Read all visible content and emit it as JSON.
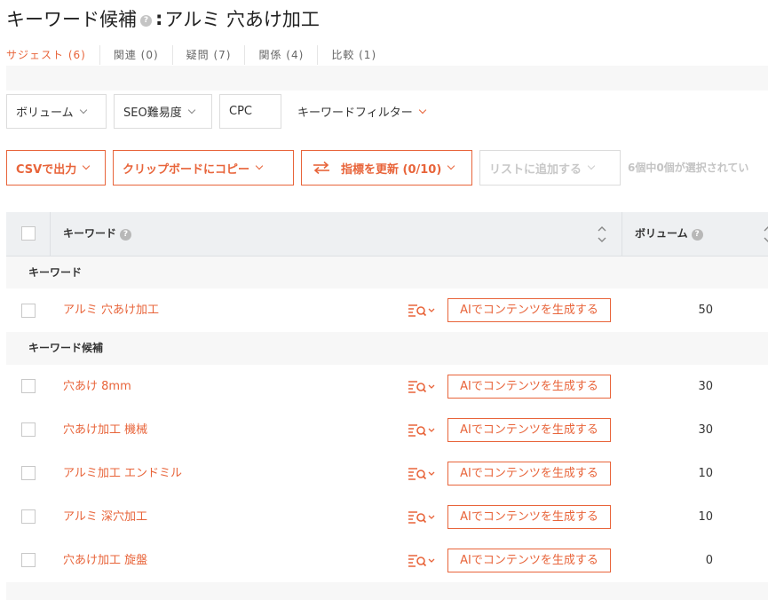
{
  "header": {
    "title_prefix": "キーワード候補",
    "help": "?",
    "colon": ":",
    "title_query": "アルミ 穴あけ加工"
  },
  "tabs": [
    {
      "label": "サジェスト (6)",
      "active": true
    },
    {
      "label": "関連 (0)"
    },
    {
      "label": "疑問 (7)"
    },
    {
      "label": "関係 (4)"
    },
    {
      "label": "比較 (1)"
    }
  ],
  "filters": {
    "volume": "ボリューム",
    "seo_difficulty": "SEO難易度",
    "cpc": "CPC",
    "keyword_filter": "キーワードフィルター"
  },
  "actions": {
    "csv": "CSVで出力",
    "clipboard": "クリップボードにコピー",
    "refresh": "指標を更新 (0/10)",
    "add_to_list": "リストに追加する",
    "selection_info": "6個中0個が選択されてい"
  },
  "table": {
    "headers": {
      "keyword": "キーワード",
      "volume": "ボリューム"
    },
    "section_keyword": "キーワード",
    "section_candidates": "キーワード候補",
    "ai_button": "AIでコンテンツを生成する",
    "main_row": {
      "keyword": "アルミ 穴あけ加工",
      "volume": "50"
    },
    "rows": [
      {
        "keyword": "穴あけ 8mm",
        "volume": "30"
      },
      {
        "keyword": "穴あけ加工 機械",
        "volume": "30"
      },
      {
        "keyword": "アルミ加工 エンドミル",
        "volume": "10"
      },
      {
        "keyword": "アルミ 深穴加工",
        "volume": "10"
      },
      {
        "keyword": "穴あけ加工 旋盤",
        "volume": "0"
      }
    ]
  },
  "colors": {
    "accent": "#e8643a",
    "header_bg": "#eef0f2",
    "band_bg": "#f7f7f7"
  },
  "icons": [
    "help-icon",
    "chevron-down-icon",
    "refresh-icon",
    "sort-icon",
    "serp-search-icon"
  ]
}
